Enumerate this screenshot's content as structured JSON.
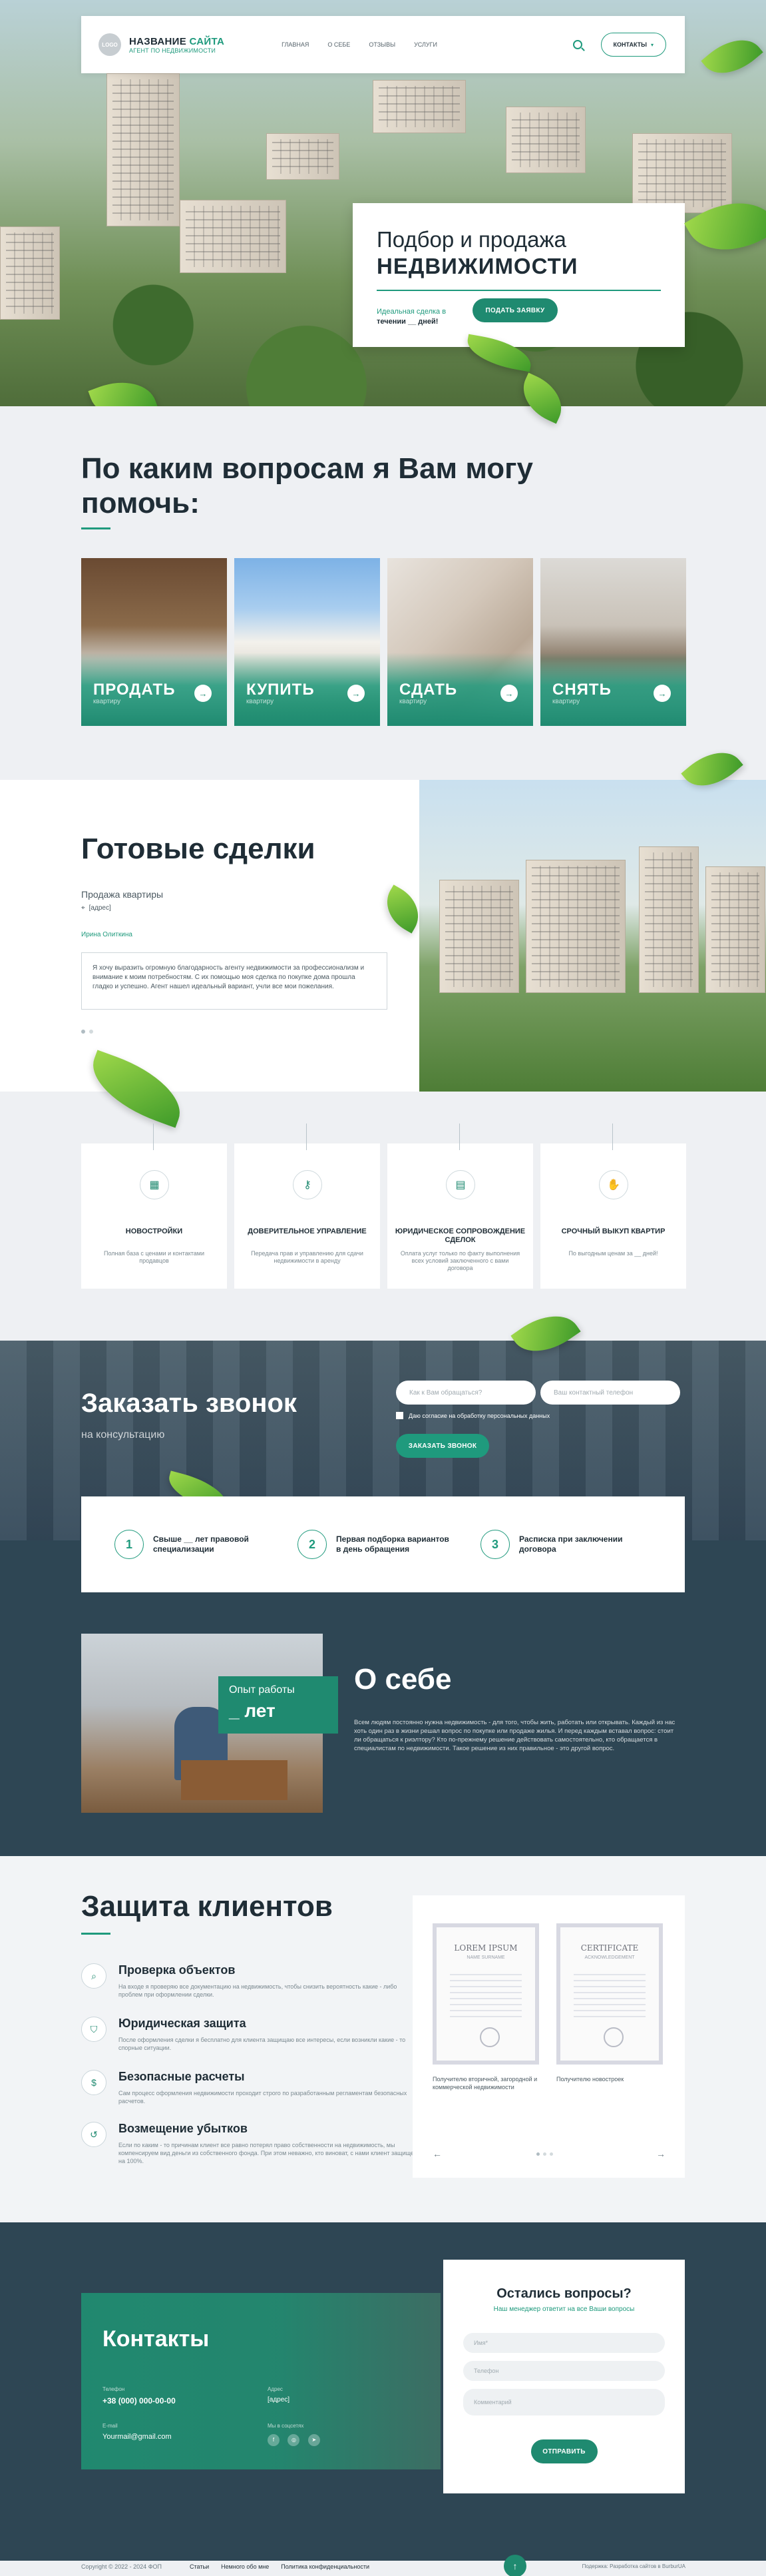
{
  "header": {
    "logo_badge": "LOGO",
    "site_name_part1": "НАЗВАНИЕ",
    "site_name_part2": "САЙТА",
    "site_subtitle": "АГЕНТ ПО НЕДВИЖИМОСТИ",
    "nav": [
      "ГЛАВНАЯ",
      "О СЕБЕ",
      "ОТЗЫВЫ",
      "УСЛУГИ"
    ],
    "contacts_button": "КОНТАКТЫ"
  },
  "hero": {
    "title_line1": "Подбор и продажа",
    "title_line2": "НЕДВИЖИМОСТИ",
    "subtitle_part1": "Идеальная сделка в",
    "subtitle_part2": "течении __ дней!",
    "cta": "ПОДАТЬ ЗАЯВКУ"
  },
  "help": {
    "title": "По каким вопросам я Вам могу помочь:",
    "cards": [
      {
        "label": "ПРОДАТЬ",
        "sub": "квартиру"
      },
      {
        "label": "КУПИТЬ",
        "sub": "квартиру"
      },
      {
        "label": "СДАТЬ",
        "sub": "квартиру"
      },
      {
        "label": "СНЯТЬ",
        "sub": "квартиру"
      }
    ]
  },
  "deals": {
    "title": "Готовые сделки",
    "subtitle": "Продажа квартиры",
    "location": "[адрес]",
    "author": "Ирина Олиткина",
    "review": "Я хочу выразить огромную благодарность агенту недвижимости за профессионализм и внимание к моим потребностям. С их помощью моя сделка по покупке дома прошла гладко и успешно. Агент нашел идеальный вариант, учли все мои пожелания."
  },
  "features": [
    {
      "title": "НОВОСТРОЙКИ",
      "desc": "Полная база с ценами и контактами продавцов"
    },
    {
      "title": "ДОВЕРИТЕЛЬНОЕ УПРАВЛЕНИЕ",
      "desc": "Передача прав и управлению для сдачи недвижимости в аренду"
    },
    {
      "title": "ЮРИДИЧЕСКОЕ СОПРОВОЖДЕНИЕ СДЕЛОК",
      "desc": "Оплата услуг только по факту выполнения всех условий заключенного с вами договора"
    },
    {
      "title": "СРОЧНЫЙ ВЫКУП КВАРТИР",
      "desc": "По выгодным ценам за __ дней!"
    }
  ],
  "callback": {
    "title": "Заказать звонок",
    "subtitle": "на консультацию",
    "name_placeholder": "Как к Вам обращаться?",
    "phone_placeholder": "Ваш контактный телефон",
    "consent": "Даю согласие на обработку персональных данных",
    "button": "ЗАКАЗАТЬ ЗВОНОК",
    "steps": [
      {
        "num": "1",
        "text": "Свыше __ лет правовой специализации"
      },
      {
        "num": "2",
        "text": "Первая подборка вариантов в день обращения"
      },
      {
        "num": "3",
        "text": "Расписка при заключении договора"
      }
    ]
  },
  "about": {
    "exp_label": "Опыт работы",
    "exp_value": "_ лет",
    "title": "О себе",
    "text": "Всем людям постоянно нужна недвижимость - для того, чтобы жить, работать или открывать. Каждый из нас хоть один раз в жизни решал вопрос по покупке или продаже жилья. И перед каждым вставал вопрос: стоит ли обращаться к риэлтору? Кто по-прежнему решение действовать самостоятельно, кто обращается в специалистам по недвижимости. Такое решение из них правильное - это другой вопрос."
  },
  "protection": {
    "title": "Защита клиентов",
    "items": [
      {
        "title": "Проверка объектов",
        "desc": "На входе я проверяю все документацию на недвижимость, чтобы снизить вероятность какие - либо проблем при оформлении сделки."
      },
      {
        "title": "Юридическая защита",
        "desc": "После оформления сделки я бесплатно для клиента защищаю все интересы, если возникли какие - то спорные ситуации."
      },
      {
        "title": "Безопасные расчеты",
        "desc": "Сам процесс оформления недвижимости проходит строго по разработанным регламентам безопасных расчетов."
      },
      {
        "title": "Возмещение убытков",
        "desc": "Если по каким - то причинам клиент все равно потерял право собственности на недвижимость, мы компенсируем вид деньги из собственного фонда. При этом неважно, кто виноват, с нами клиент защищен на 100%."
      }
    ],
    "certs": [
      {
        "heading": "LOREM IPSUM",
        "sub": "NAME SURNAME",
        "caption": "Получителю вторичной, загородной и коммерческой недвижимости"
      },
      {
        "heading": "CERTIFICATE",
        "sub": "ACKNOWLEDGEMENT",
        "caption": "Получителю новостроек"
      }
    ],
    "prev": "←",
    "next": "→"
  },
  "contacts": {
    "title": "Контакты",
    "phone_label": "Телефон",
    "phone": "+38 (000) 000-00-00",
    "address_label": "Адрес",
    "address": "[адрес]",
    "email_label": "E-mail",
    "email": "Yourmail@gmail.com",
    "social_label": "Мы в соцсетях",
    "form_title": "Остались вопросы?",
    "form_subtitle": "Наш менеджер ответит на все Ваши вопросы",
    "field_name": "Имя*",
    "field_phone": "Телефон",
    "field_comment": "Комментарий",
    "submit": "ОТПРАВИТЬ"
  },
  "footer": {
    "copyright": "Copyright © 2022 - 2024 ФОП",
    "links": [
      "Статьи",
      "Немного обо мне",
      "Политика конфиденциальности"
    ],
    "credit": "Подержка: Разработка сайтов в BurburUA"
  }
}
